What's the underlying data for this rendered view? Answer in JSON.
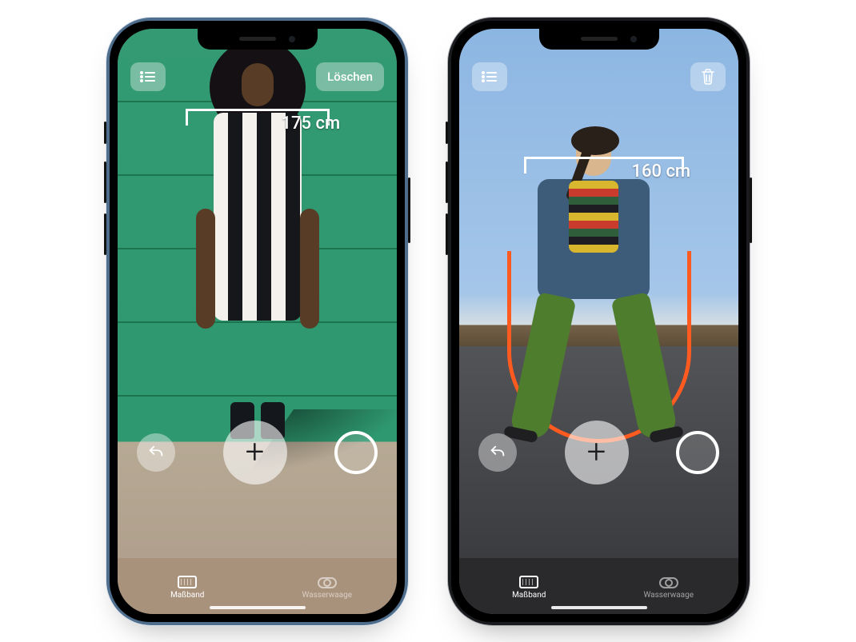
{
  "left_phone": {
    "top": {
      "list_icon": "list-icon",
      "clear_label": "Löschen"
    },
    "measurement": "175 cm",
    "capture": {
      "undo_icon": "undo-icon",
      "add_icon": "plus-icon",
      "shutter_icon": "shutter-icon"
    },
    "tabs": {
      "measure_label": "Maßband",
      "level_label": "Wasserwaage",
      "active": "measure"
    }
  },
  "right_phone": {
    "top": {
      "list_icon": "list-icon",
      "trash_icon": "trash-icon"
    },
    "measurement": "160 cm",
    "capture": {
      "undo_icon": "undo-icon",
      "add_icon": "plus-icon",
      "shutter_icon": "shutter-icon"
    },
    "tabs": {
      "measure_label": "Maßband",
      "level_label": "Wasserwaage",
      "active": "measure"
    }
  }
}
